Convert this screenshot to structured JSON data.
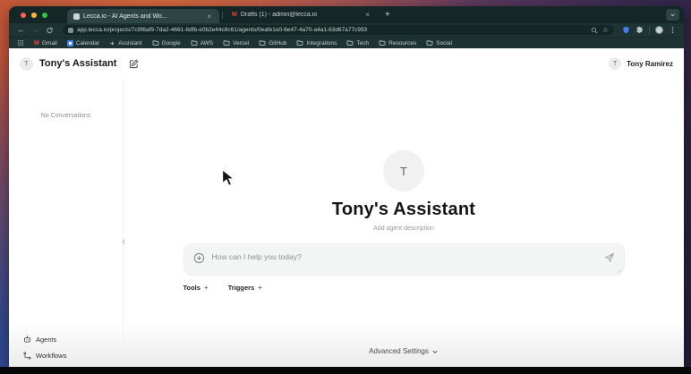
{
  "browser": {
    "tabs": [
      {
        "title": "Lecca.io - AI Agents and Wo...",
        "close": "×"
      },
      {
        "title": "Drafts (1) - admin@lecca.io",
        "close": "×"
      }
    ],
    "new_tab_label": "+",
    "back": "←",
    "forward": "→",
    "url": "app.lecca.io/projects/7c9f6af9-7da2-4661-8dfb-e0b2e44c8c61/agents/0eafe1e0-6e47-4a70-a4a1-63d67a77c993",
    "star": "☆",
    "gmail_letter": "M",
    "bookmarks": [
      {
        "label": "Gmail"
      },
      {
        "label": "Calendar"
      },
      {
        "label": "Assistant"
      },
      {
        "label": "Google"
      },
      {
        "label": "AWS"
      },
      {
        "label": "Vercel"
      },
      {
        "label": "GitHub"
      },
      {
        "label": "Integrations"
      },
      {
        "label": "Tech"
      },
      {
        "label": "Resources"
      },
      {
        "label": "Social"
      }
    ]
  },
  "app": {
    "header": {
      "agent_avatar_letter": "T",
      "title": "Tony's Assistant",
      "user_avatar_letter": "T",
      "user_name": "Tony Ramirez"
    },
    "sidebar": {
      "empty_state": "No Conversations",
      "nav": [
        {
          "label": "Agents"
        },
        {
          "label": "Workflows"
        }
      ]
    },
    "main": {
      "agent_avatar_letter": "T",
      "agent_name": "Tony's Assistant",
      "description_placeholder": "Add agent description",
      "chat_placeholder": "How can I help you today?",
      "tools_label": "Tools",
      "triggers_label": "Triggers",
      "add_symbol": "+",
      "advanced_settings_label": "Advanced Settings"
    }
  },
  "colors": {
    "traffic_red": "#ff5f57",
    "traffic_yellow": "#febc2e",
    "traffic_green": "#28c840",
    "chrome_tabstrip": "#142626",
    "chrome_toolbar": "#1e3434",
    "active_tab": "#2c4443",
    "gmail_red": "#ea4335",
    "calendar_blue": "#4285f4",
    "shield_blue": "#4a7df0"
  }
}
